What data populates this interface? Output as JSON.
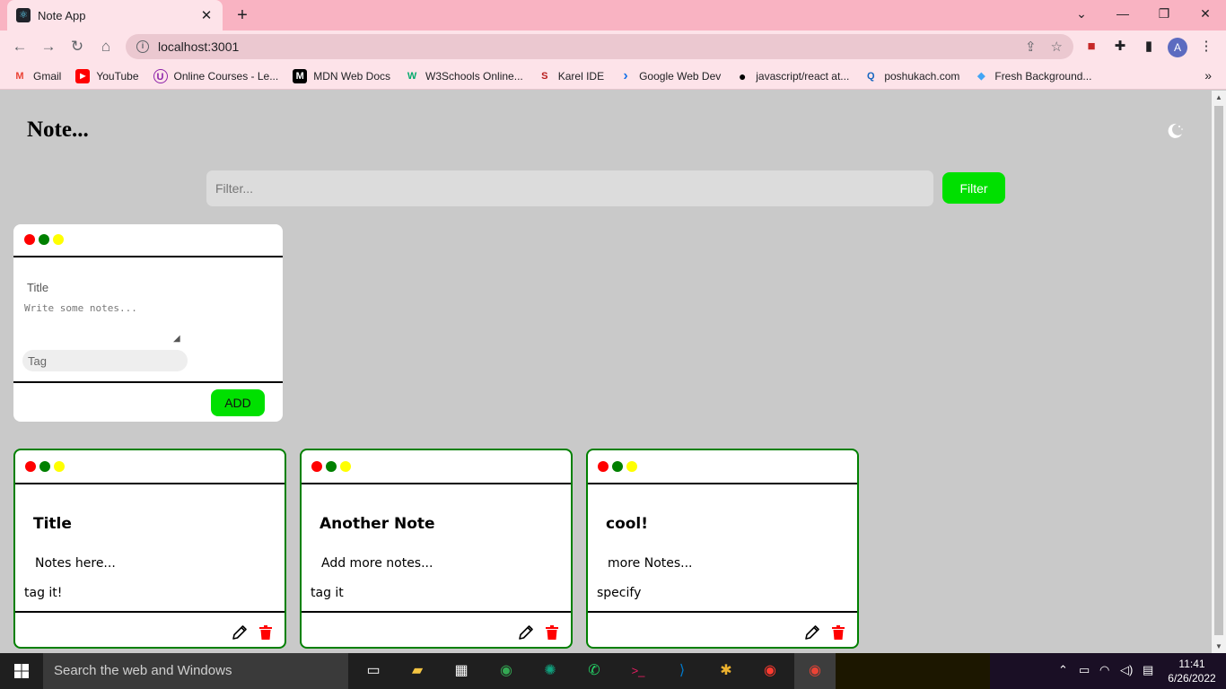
{
  "browser": {
    "tab_title": "Note App",
    "tab_close": "✕",
    "new_tab": "+",
    "url": "localhost:3001",
    "window_controls": {
      "minimize": "—",
      "restore": "❐",
      "close": "✕",
      "tab_search": "⌄"
    },
    "profile_initial": "A",
    "bookmarks": [
      {
        "label": "Gmail",
        "icon": "gmail-icon",
        "color": "#ea4335",
        "glyph": "M"
      },
      {
        "label": "YouTube",
        "icon": "youtube-icon",
        "color": "#ff0000",
        "glyph": "▶"
      },
      {
        "label": "Online Courses - Le...",
        "icon": "courses-icon",
        "color": "#8e24aa",
        "glyph": "U"
      },
      {
        "label": "MDN Web Docs",
        "icon": "mdn-icon",
        "color": "#000000",
        "glyph": "M"
      },
      {
        "label": "W3Schools Online...",
        "icon": "w3schools-icon",
        "color": "#04aa6d",
        "glyph": "W"
      },
      {
        "label": "Karel IDE",
        "icon": "karel-icon",
        "color": "#b71c1c",
        "glyph": "S"
      },
      {
        "label": "Google Web Dev",
        "icon": "webdev-icon",
        "color": "#1a73e8",
        "glyph": "›"
      },
      {
        "label": "javascript/react at...",
        "icon": "github-icon",
        "color": "#000000",
        "glyph": "●"
      },
      {
        "label": "poshukach.com",
        "icon": "search-engine-icon",
        "color": "#1565c0",
        "glyph": "Q"
      },
      {
        "label": "Fresh Background...",
        "icon": "background-ext-icon",
        "color": "#42a5f5",
        "glyph": "◆"
      }
    ]
  },
  "app": {
    "title": "Note...",
    "filter": {
      "placeholder": "Filter...",
      "button_label": "Filter"
    },
    "new_note": {
      "title_placeholder": "Title",
      "notes_placeholder": "Write some notes...",
      "tag_placeholder": "Tag",
      "add_label": "ADD"
    },
    "notes": [
      {
        "title": "Title",
        "body": "Notes here...",
        "tag": "tag it!"
      },
      {
        "title": "Another Note",
        "body": "Add more notes...",
        "tag": "tag it"
      },
      {
        "title": "cool!",
        "body": "more Notes...",
        "tag": "specify"
      }
    ],
    "colors": {
      "accent_green": "#00e000",
      "card_border": "#008000",
      "dot_red": "#ff0000",
      "dot_green": "#008000",
      "dot_yellow": "#ffff00",
      "delete_red": "#ff0000",
      "page_bg": "#c9c9c9"
    }
  },
  "taskbar": {
    "search_placeholder": "Search the web and Windows",
    "time": "11:41",
    "date": "6/26/2022"
  }
}
